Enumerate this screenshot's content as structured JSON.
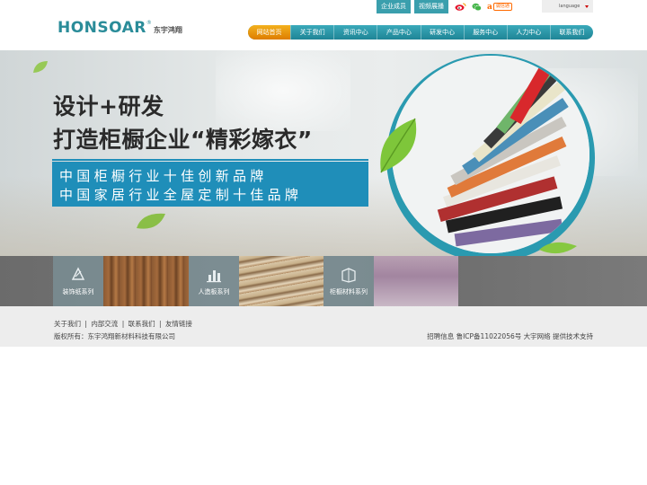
{
  "header": {
    "logo_en": "HONSOAR",
    "logo_reg": "®",
    "logo_cn": "东宇鸿翔",
    "top_links": [
      "企业成员",
      "视频展播"
    ],
    "alibaba_mark": "a",
    "alibaba_text": "诚信通",
    "language": "language"
  },
  "nav": {
    "items": [
      "网站首页",
      "关于我们",
      "资讯中心",
      "产品中心",
      "研发中心",
      "服务中心",
      "人力中心",
      "联系我们"
    ],
    "active_index": 0
  },
  "banner": {
    "headline_1": "设计+研发",
    "headline_2": "打造柜橱企业“精彩嫁衣”",
    "slogan_1": "中国柜橱行业十佳创新品牌",
    "slogan_2": "中国家居行业全屋定制十佳品牌"
  },
  "products": [
    {
      "label": "装饰纸系列",
      "icon": "paper-icon"
    },
    {
      "label": "人造板系列",
      "icon": "board-chart-icon"
    },
    {
      "label": "柜橱材料系列",
      "icon": "cabinet-material-icon"
    }
  ],
  "footer": {
    "links": [
      "关于我们",
      "内部交流",
      "联系我们",
      "友情链接"
    ],
    "separator": "|",
    "copyright": "版权所有：东宇鸿翔新材料科技有限公司",
    "right_text": "招聘信息 鲁ICP备11022056号 大宇网络 提供技术支持"
  },
  "colors": {
    "teal": "#2a8c99",
    "nav": "#1f8596",
    "active": "#e89400",
    "slogan_bg": "#1f8eb9"
  }
}
